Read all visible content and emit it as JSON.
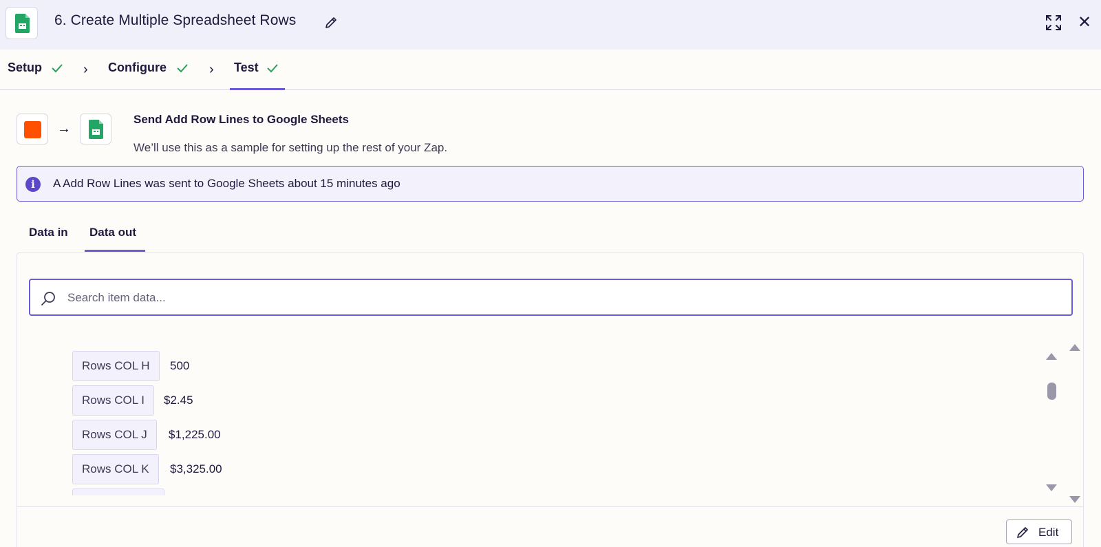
{
  "header": {
    "title": "6. Create Multiple Spreadsheet Rows",
    "app_icon": "google-sheets-icon"
  },
  "steps": [
    {
      "label": "Setup",
      "complete": true
    },
    {
      "label": "Configure",
      "complete": true
    },
    {
      "label": "Test",
      "complete": true,
      "active": true
    }
  ],
  "sample": {
    "title": "Send Add Row Lines to Google Sheets",
    "subtitle": "We’ll use this as a sample for setting up the rest of your Zap.",
    "source_color": "#ff4f00"
  },
  "info": {
    "message": "A Add Row Lines was sent to Google Sheets about 15 minutes ago"
  },
  "data_tabs": [
    {
      "label": "Data in",
      "active": false
    },
    {
      "label": "Data out",
      "active": true
    }
  ],
  "search": {
    "placeholder": "Search item data..."
  },
  "rows": [
    {
      "key": "Rows COL H",
      "value": "500"
    },
    {
      "key": "Rows COL I",
      "value": "$2.45"
    },
    {
      "key": "Rows COL J",
      "value": "$1,225.00"
    },
    {
      "key": "Rows COL K",
      "value": "$3,325.00"
    }
  ],
  "footer": {
    "edit_label": "Edit"
  },
  "colors": {
    "accent": "#6b5bd6",
    "sheets_green": "#23a566",
    "check_green": "#2e9e5b"
  }
}
